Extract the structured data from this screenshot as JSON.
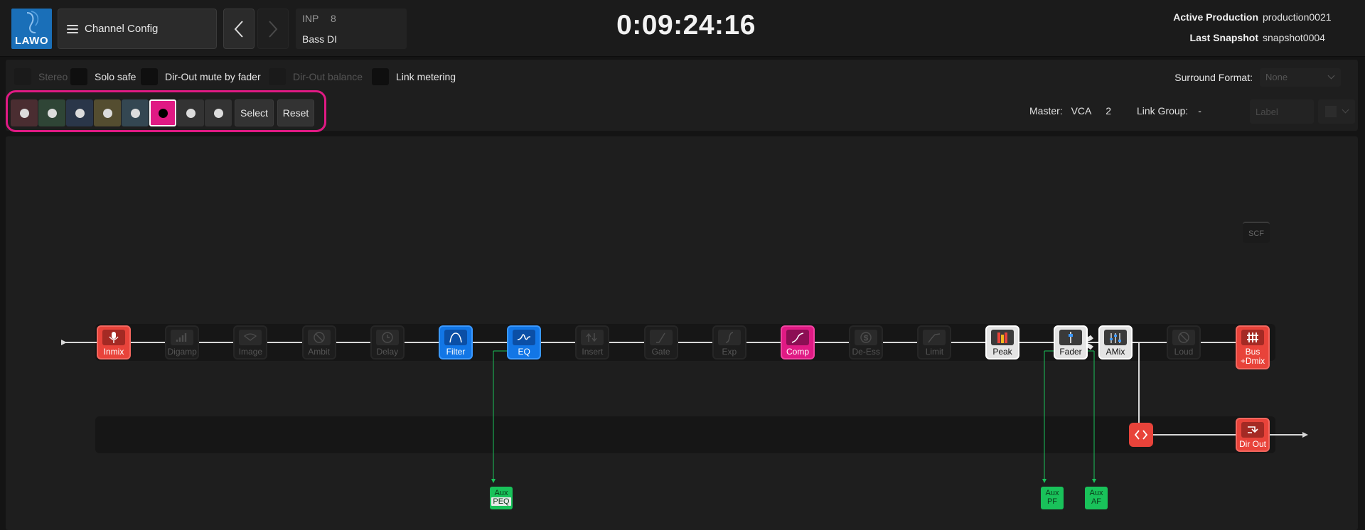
{
  "header": {
    "logo_text": "LAWO",
    "menu_label": "Channel Config",
    "channel": {
      "type": "INP",
      "number": "8",
      "name": "Bass DI"
    },
    "timecode": "0:09:24:16",
    "active_production_label": "Active Production",
    "active_production_value": "production0021",
    "last_snapshot_label": "Last Snapshot",
    "last_snapshot_value": "snapshot0004"
  },
  "options": {
    "stereo": "Stereo",
    "solo_safe": "Solo safe",
    "dir_out_mute": "Dir-Out mute by fader",
    "dir_out_balance": "Dir-Out balance",
    "link_metering": "Link metering",
    "surround_label": "Surround Format:",
    "surround_value": "None"
  },
  "colors": {
    "swatches": [
      "#4a2d31",
      "#2f4536",
      "#2a3649",
      "#544d30",
      "#344752",
      "#e01a84",
      "#333333",
      "#333333"
    ],
    "selected_index": 5,
    "accent": "#e01a84",
    "select_label": "Select",
    "reset_label": "Reset"
  },
  "master": {
    "master_label": "Master:",
    "vca_label": "VCA",
    "vca_value": "2",
    "link_group_label": "Link Group:",
    "link_group_value": "-",
    "label_placeholder": "Label"
  },
  "flow": {
    "modules": [
      {
        "name": "Inmix",
        "state": "on-red",
        "icon": "microphone-icon"
      },
      {
        "name": "Digamp",
        "state": "dim",
        "icon": "digamp-icon"
      },
      {
        "name": "Image",
        "state": "dim",
        "icon": "image-icon"
      },
      {
        "name": "Ambit",
        "state": "dim",
        "icon": "ambit-icon"
      },
      {
        "name": "Delay",
        "state": "dim",
        "icon": "clock-icon"
      },
      {
        "name": "Filter",
        "state": "on-blue",
        "icon": "filter-icon"
      },
      {
        "name": "EQ",
        "state": "on-blue",
        "icon": "eq-icon"
      },
      {
        "name": "Insert",
        "state": "dim",
        "icon": "insert-icon"
      },
      {
        "name": "Gate",
        "state": "dim",
        "icon": "gate-icon"
      },
      {
        "name": "Exp",
        "state": "dim",
        "icon": "expander-icon"
      },
      {
        "name": "Comp",
        "state": "on-pink",
        "icon": "compressor-icon"
      },
      {
        "name": "De-Ess",
        "state": "dim",
        "icon": "deesser-icon"
      },
      {
        "name": "Limit",
        "state": "dim",
        "icon": "limiter-icon"
      },
      {
        "name": "Peak",
        "state": "on-white",
        "icon": "peak-meter-icon"
      },
      {
        "name": "Fader",
        "state": "on-white",
        "icon": "fader-icon"
      },
      {
        "name": "AMix",
        "state": "on-white",
        "icon": "automix-icon"
      },
      {
        "name": "Loud",
        "state": "dim",
        "icon": "loudness-icon"
      }
    ],
    "bus_label_1": "Bus",
    "bus_label_2": "+Dmix",
    "scf_label": "SCF",
    "dir_out_label": "Dir Out",
    "aux_peq_1": "Aux",
    "aux_peq_2": "PEQ",
    "aux_pf_1": "Aux",
    "aux_pf_2": "PF",
    "aux_af_1": "Aux",
    "aux_af_2": "AF"
  }
}
